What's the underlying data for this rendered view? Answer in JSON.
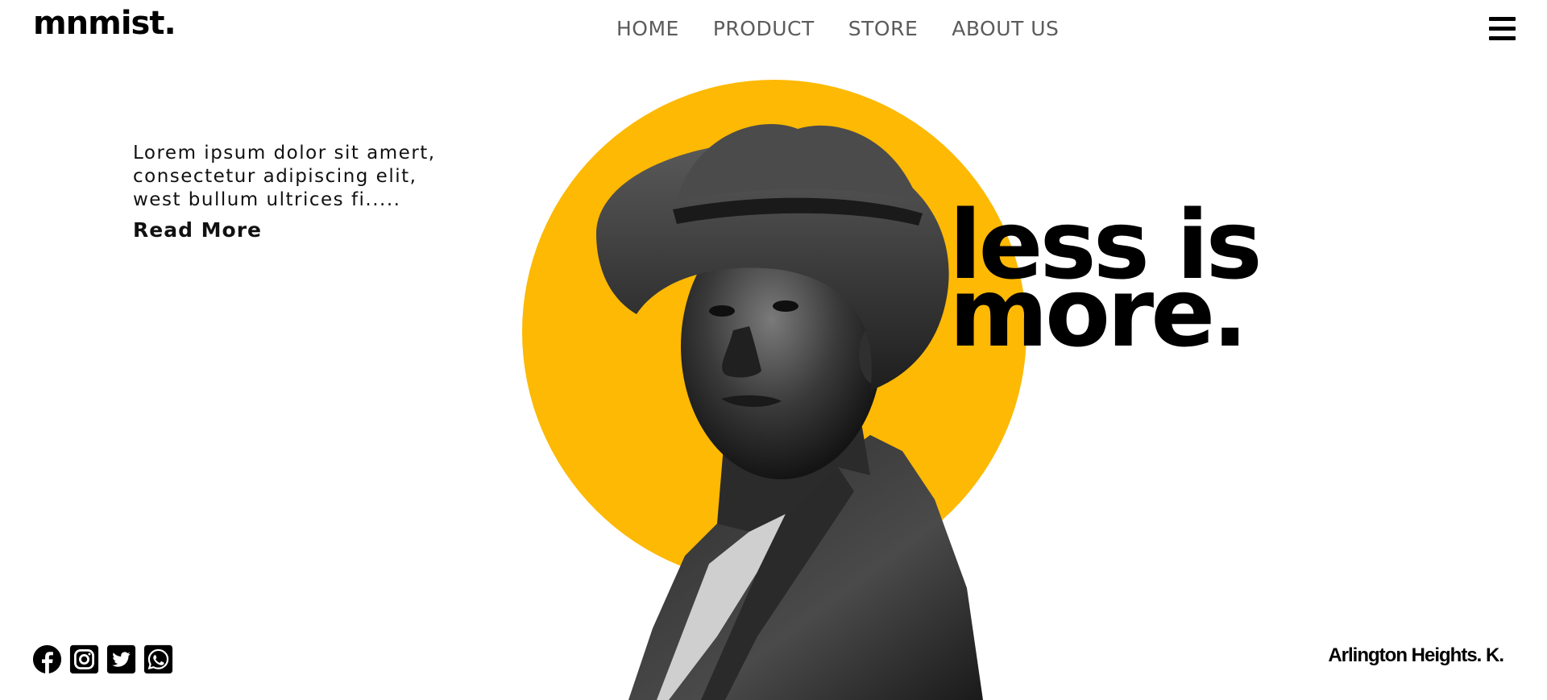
{
  "brand": {
    "logo": "mnmist."
  },
  "nav": {
    "items": [
      "HOME",
      "PRODUCT",
      "STORE",
      "ABOUT US"
    ]
  },
  "menu": {
    "icon": "hamburger-menu-icon"
  },
  "intro": {
    "line1": "Lorem ipsum dolor sit amert,",
    "line2": "consectetur adipiscing elit,",
    "line3": "west bullum ultrices fi.....",
    "read_more": "Read More"
  },
  "hero": {
    "headline_line1": "less is",
    "headline_line2": "more.",
    "accent_color": "#FDB904",
    "image": "man-in-hat-portrait"
  },
  "socials": {
    "icons": [
      "facebook-icon",
      "instagram-icon",
      "twitter-icon",
      "whatsapp-icon"
    ]
  },
  "footer": {
    "location": "Arlington Heights. K."
  }
}
